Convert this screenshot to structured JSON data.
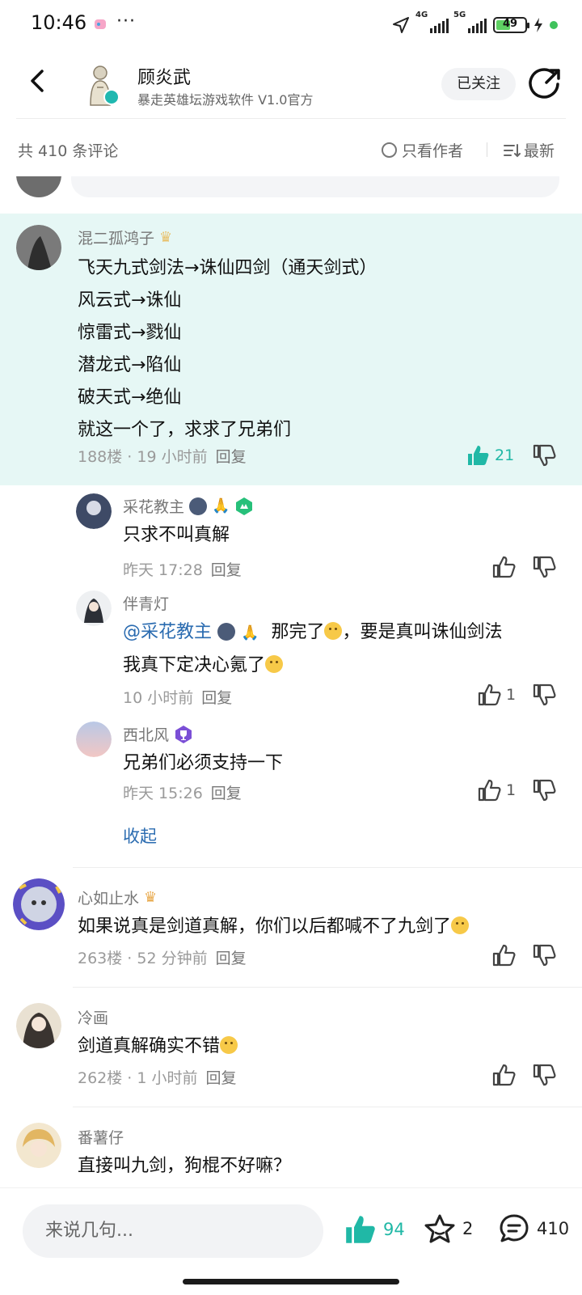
{
  "status_bar": {
    "time": "10:46",
    "more": "···",
    "net1": "4G",
    "net2": "5G",
    "battery": "49"
  },
  "header": {
    "author_name": "顾炎武",
    "author_sub": "暴走英雄坛游戏软件 V1.0官方",
    "follow_label": "已关注"
  },
  "comment_bar": {
    "count_label": "共 410 条评论",
    "author_only_label": "只看作者",
    "sort_label": "最新"
  },
  "main_comment": {
    "user": "混二孤鸿子",
    "lines": [
      "飞天九式剑法→诛仙四剑（通天剑式）",
      "风云式→诛仙",
      "惊雷式→戮仙",
      "潜龙式→陷仙",
      "破天式→绝仙",
      "就这一个了，求求了兄弟们"
    ],
    "meta": "188楼 · 19 小时前",
    "reply": "回复",
    "likes": "21"
  },
  "replies": [
    {
      "user": "采花教主",
      "text": "只求不叫真解",
      "meta": "昨天 17:28",
      "reply": "回复",
      "likes": ""
    },
    {
      "user": "伴青灯",
      "mention": "@采花教主",
      "text1": "那完了",
      "text2": "，要是真叫诛仙剑法",
      "text3": "我真下定决心氪了",
      "meta": "10 小时前",
      "reply": "回复",
      "likes": "1"
    },
    {
      "user": "西北风",
      "text": "兄弟们必须支持一下",
      "meta": "昨天 15:26",
      "reply": "回复",
      "likes": "1"
    }
  ],
  "collapse_label": "收起",
  "comments": [
    {
      "user": "心如止水",
      "text": "如果说真是剑道真解，你们以后都喊不了九剑了",
      "meta": "263楼 · 52 分钟前",
      "reply": "回复"
    },
    {
      "user": "冷画",
      "text": "剑道真解确实不错",
      "meta": "262楼 · 1 小时前",
      "reply": "回复"
    },
    {
      "user": "番薯仔",
      "text": "直接叫九剑，狗棍不好嘛？"
    }
  ],
  "bottom_bar": {
    "input_placeholder": "来说几句...",
    "like_count": "94",
    "fav_count": "2",
    "comment_count": "410"
  },
  "colors": {
    "accent": "#20b8a6",
    "highlight_bg": "#e6f7f5",
    "link": "#2a6bb0"
  }
}
